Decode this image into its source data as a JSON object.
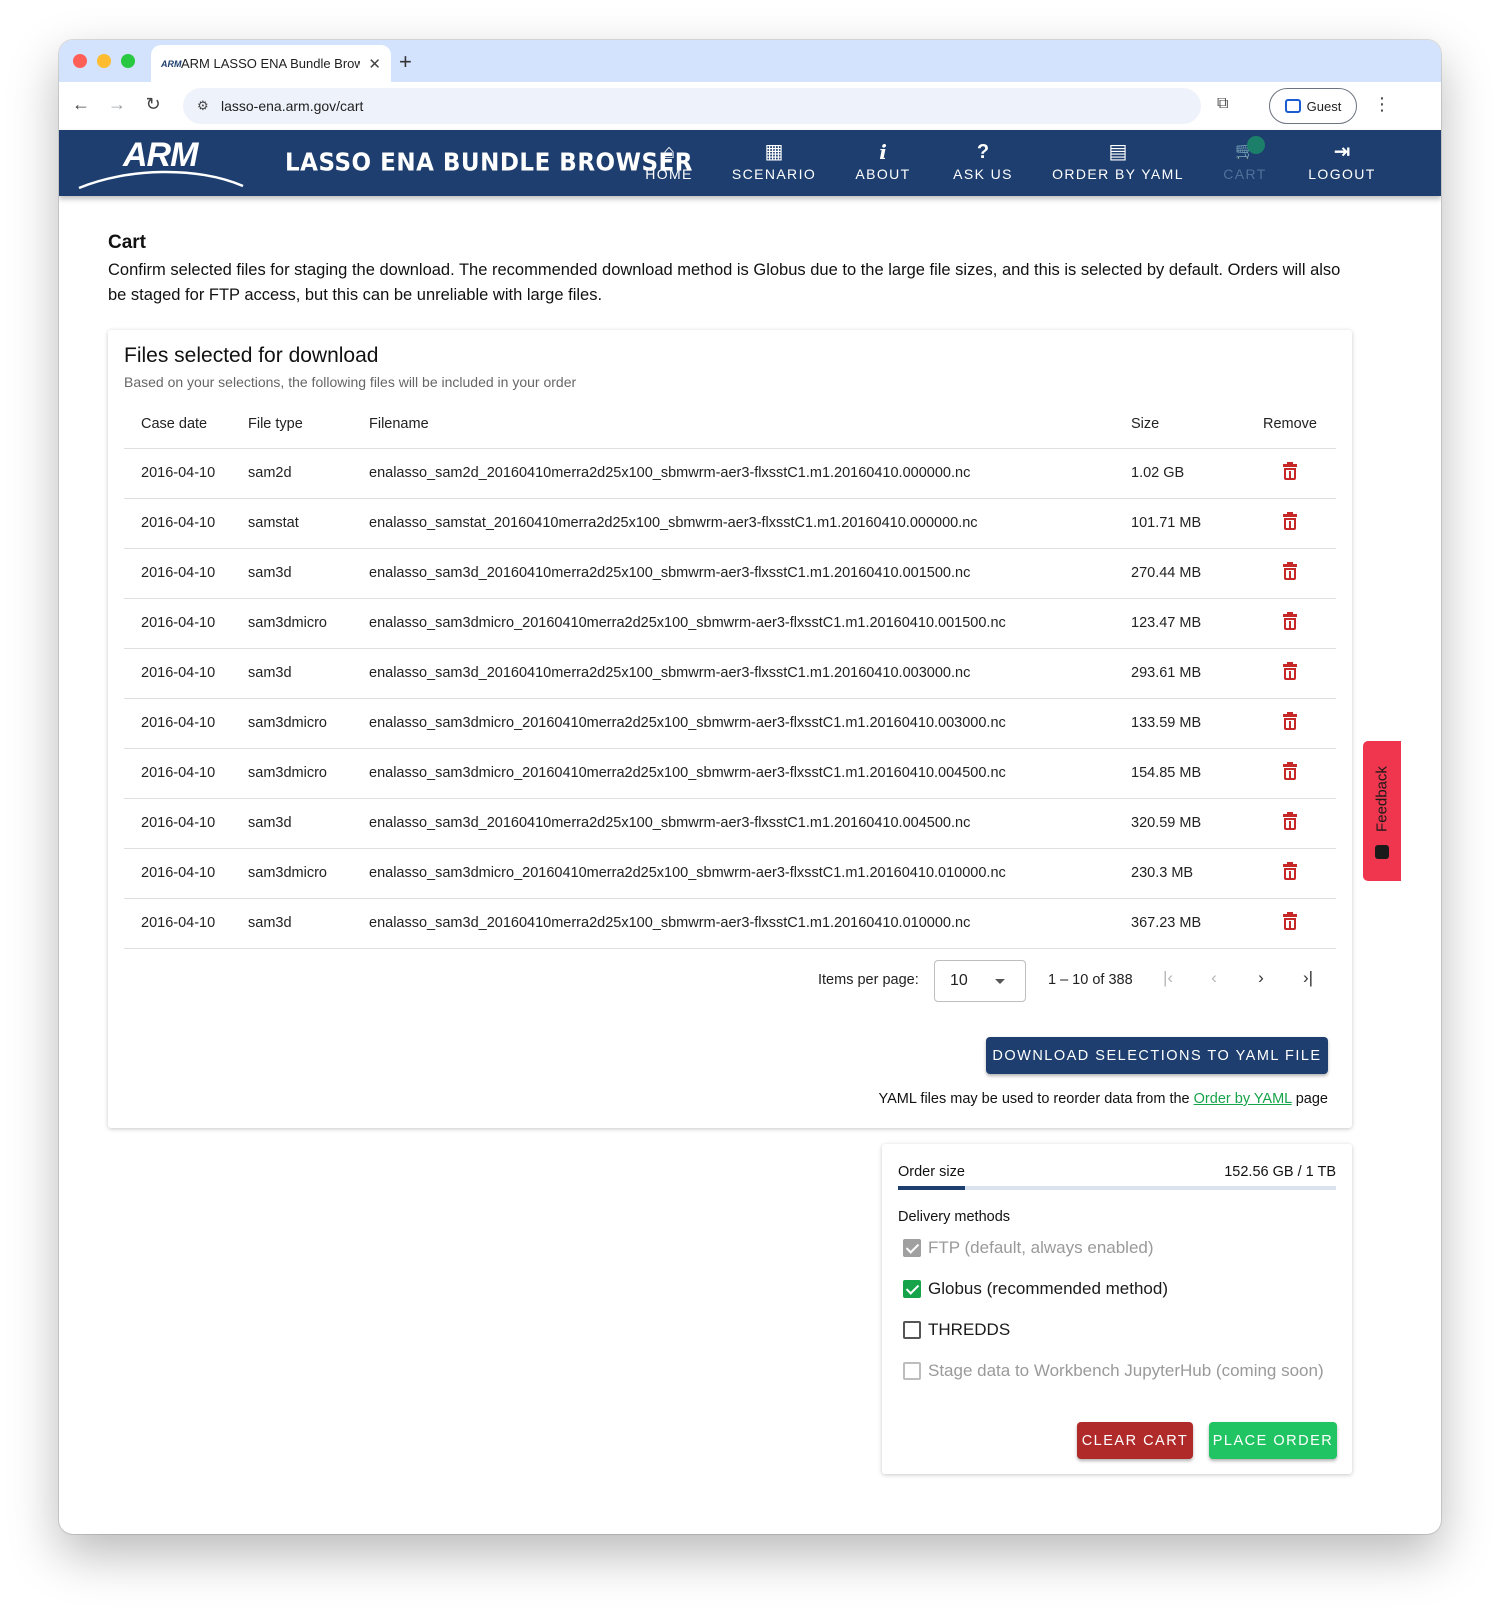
{
  "browser": {
    "tab_title": "ARM LASSO ENA Bundle Brow",
    "tab_favicon": "ARM",
    "url": "lasso-ena.arm.gov/cart",
    "profile_label": "Guest"
  },
  "header": {
    "logo_text": "ARM",
    "app_title": "LASSO ENA BUNDLE BROWSER",
    "nav": [
      {
        "label": "HOME",
        "icon": "home-icon",
        "glyph": "⌂",
        "enabled": true
      },
      {
        "label": "SCENARIO",
        "icon": "chart-icon",
        "glyph": "▦",
        "enabled": true
      },
      {
        "label": "ABOUT",
        "icon": "info-icon",
        "glyph": "i",
        "enabled": true
      },
      {
        "label": "ASK US",
        "icon": "question-icon",
        "glyph": "?",
        "enabled": true
      },
      {
        "label": "ORDER BY YAML",
        "icon": "file-icon",
        "glyph": "▤",
        "enabled": true
      },
      {
        "label": "CART",
        "icon": "cart-icon",
        "glyph": "🛒",
        "enabled": false
      },
      {
        "label": "LOGOUT",
        "icon": "logout-icon",
        "glyph": "⇥",
        "enabled": true
      }
    ]
  },
  "page": {
    "heading": "Cart",
    "description": "Confirm selected files for staging the download. The recommended download method is Globus due to the large file sizes, and this is selected by default. Orders will also be staged for FTP access, but this can be unreliable with large files."
  },
  "files_card": {
    "title": "Files selected for download",
    "subtitle": "Based on your selections, the following files will be included in your order",
    "columns": [
      "Case date",
      "File type",
      "Filename",
      "Size",
      "Remove"
    ],
    "rows": [
      {
        "date": "2016-04-10",
        "type": "sam2d",
        "filename": "enalasso_sam2d_20160410merra2d25x100_sbmwrm-aer3-flxsstC1.m1.20160410.000000.nc",
        "size": "1.02 GB"
      },
      {
        "date": "2016-04-10",
        "type": "samstat",
        "filename": "enalasso_samstat_20160410merra2d25x100_sbmwrm-aer3-flxsstC1.m1.20160410.000000.nc",
        "size": "101.71 MB"
      },
      {
        "date": "2016-04-10",
        "type": "sam3d",
        "filename": "enalasso_sam3d_20160410merra2d25x100_sbmwrm-aer3-flxsstC1.m1.20160410.001500.nc",
        "size": "270.44 MB"
      },
      {
        "date": "2016-04-10",
        "type": "sam3dmicro",
        "filename": "enalasso_sam3dmicro_20160410merra2d25x100_sbmwrm-aer3-flxsstC1.m1.20160410.001500.nc",
        "size": "123.47 MB"
      },
      {
        "date": "2016-04-10",
        "type": "sam3d",
        "filename": "enalasso_sam3d_20160410merra2d25x100_sbmwrm-aer3-flxsstC1.m1.20160410.003000.nc",
        "size": "293.61 MB"
      },
      {
        "date": "2016-04-10",
        "type": "sam3dmicro",
        "filename": "enalasso_sam3dmicro_20160410merra2d25x100_sbmwrm-aer3-flxsstC1.m1.20160410.003000.nc",
        "size": "133.59 MB"
      },
      {
        "date": "2016-04-10",
        "type": "sam3dmicro",
        "filename": "enalasso_sam3dmicro_20160410merra2d25x100_sbmwrm-aer3-flxsstC1.m1.20160410.004500.nc",
        "size": "154.85 MB"
      },
      {
        "date": "2016-04-10",
        "type": "sam3d",
        "filename": "enalasso_sam3d_20160410merra2d25x100_sbmwrm-aer3-flxsstC1.m1.20160410.004500.nc",
        "size": "320.59 MB"
      },
      {
        "date": "2016-04-10",
        "type": "sam3dmicro",
        "filename": "enalasso_sam3dmicro_20160410merra2d25x100_sbmwrm-aer3-flxsstC1.m1.20160410.010000.nc",
        "size": "230.3 MB"
      },
      {
        "date": "2016-04-10",
        "type": "sam3d",
        "filename": "enalasso_sam3d_20160410merra2d25x100_sbmwrm-aer3-flxsstC1.m1.20160410.010000.nc",
        "size": "367.23 MB"
      }
    ],
    "paginator": {
      "items_per_page_label": "Items per page:",
      "items_per_page": "10",
      "range": "1 – 10 of 388"
    },
    "download_button": "DOWNLOAD SELECTIONS TO YAML FILE",
    "yaml_note_before": "YAML files may be used to reorder data from the ",
    "yaml_note_link": "Order by YAML",
    "yaml_note_after": " page"
  },
  "order_card": {
    "order_size_label": "Order size",
    "order_size_value": "152.56 GB / 1 TB",
    "order_size_fraction": 0.1526,
    "delivery_label": "Delivery methods",
    "methods": [
      {
        "label": "FTP (default, always enabled)",
        "checked": true,
        "disabled": true
      },
      {
        "label": "Globus (recommended method)",
        "checked": true,
        "disabled": false
      },
      {
        "label": "THREDDS",
        "checked": false,
        "disabled": false
      },
      {
        "label": "Stage data to Workbench JupyterHub (coming soon)",
        "checked": false,
        "disabled": true
      }
    ],
    "clear_button": "CLEAR CART",
    "place_button": "PLACE ORDER"
  },
  "feedback": {
    "label": "Feedback"
  },
  "colors": {
    "brand": "#1d3e6e",
    "danger": "#c62828",
    "success": "#21c463",
    "feedback": "#f0364f"
  }
}
